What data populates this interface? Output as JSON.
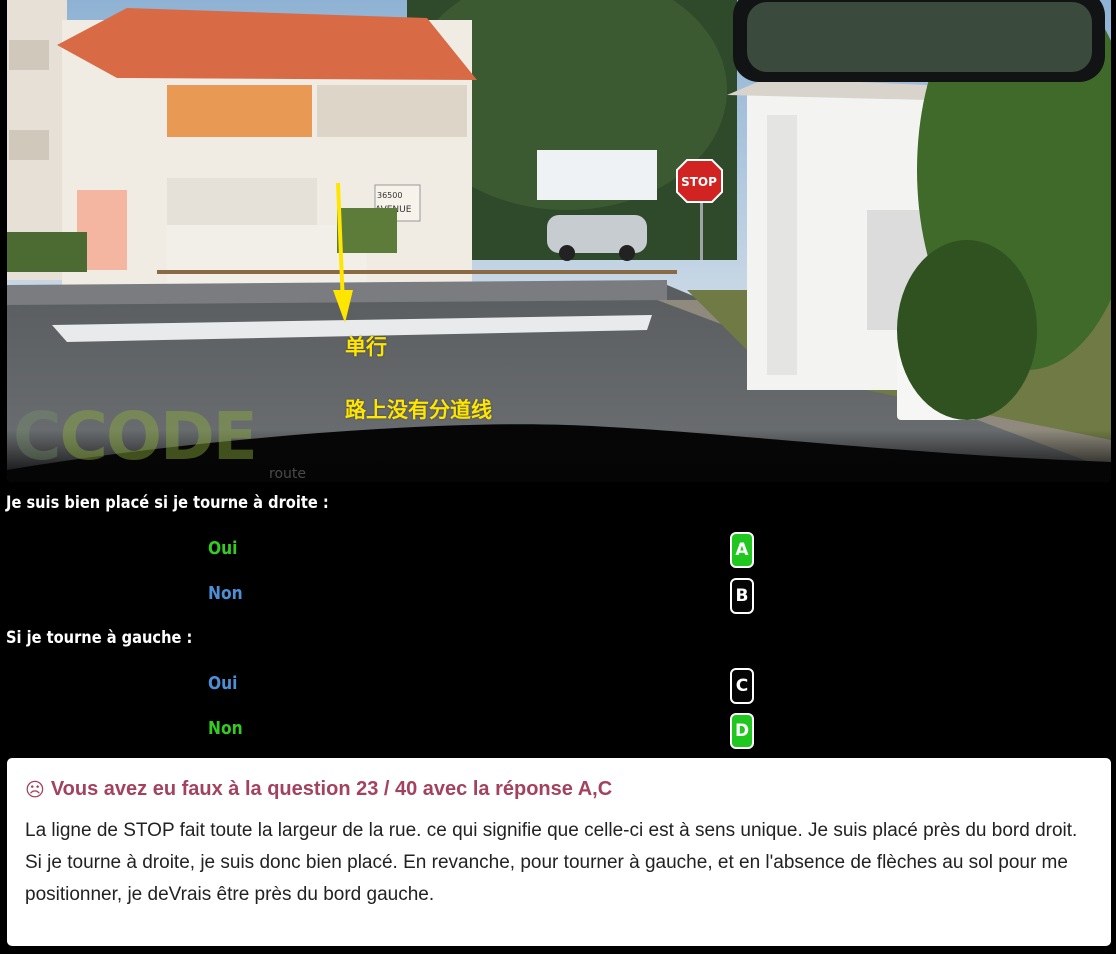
{
  "photo": {
    "stop_sign_text": "STOP",
    "annotation_one_way": "单行",
    "annotation_no_lanes": "路上没有分道线",
    "watermark_text": "CODE",
    "watermark_suffix": "route",
    "building_sign": "36500 AVENUE"
  },
  "questions": [
    {
      "text": "Je suis bien placé si je tourne à droite :",
      "answers": [
        {
          "label": "Oui",
          "letter": "A",
          "state": "correct"
        },
        {
          "label": "Non",
          "letter": "B",
          "state": "neutral"
        }
      ]
    },
    {
      "text": "Si je tourne à gauche :",
      "answers": [
        {
          "label": "Oui",
          "letter": "C",
          "state": "neutral"
        },
        {
          "label": "Non",
          "letter": "D",
          "state": "correct"
        }
      ]
    }
  ],
  "feedback": {
    "icon": "sad-face-icon",
    "icon_glyph": "☹",
    "title": "Vous avez eu faux à la question 23 / 40 avec la réponse A,C",
    "body": "La ligne de STOP fait toute la largeur de la rue. ce qui signifie que celle-ci est à sens unique. Je suis placé près du bord droit. Si je tourne à droite, je suis donc bien placé. En revanche, pour tourner à gauche, et en l'absence de flèches au sol pour me positionner, je deVrais être près du bord gauche."
  },
  "colors": {
    "correct_text": "#33cc1f",
    "neutral_text": "#4d8fd6",
    "correct_button": "#1fc71f",
    "feedback_title": "#a3425e",
    "annotation": "#ffe600"
  }
}
